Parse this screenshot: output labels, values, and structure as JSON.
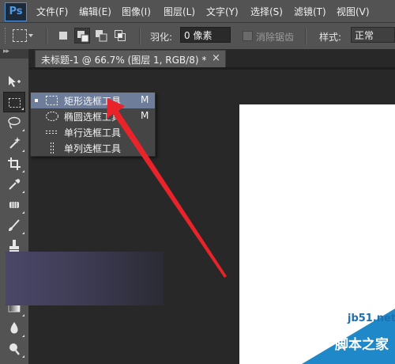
{
  "app": {
    "logo_text": "Ps"
  },
  "menu": {
    "items": [
      "文件(F)",
      "编辑(E)",
      "图像(I)",
      "图层(L)",
      "文字(Y)",
      "选择(S)",
      "滤镜(T)",
      "视图(V)"
    ]
  },
  "options_bar": {
    "feather_label": "羽化:",
    "feather_value": "0 像素",
    "antialias_label": "消除锯齿",
    "style_label": "样式:",
    "style_value": "正常"
  },
  "document": {
    "tab_title": "未标题-1 @ 66.7% (图层 1, RGB/8) *",
    "close_glyph": "×"
  },
  "flyout": {
    "items": [
      {
        "label": "矩形选框工具",
        "shortcut": "M",
        "icon": "rectangular-marquee-icon"
      },
      {
        "label": "椭圆选框工具",
        "shortcut": "M",
        "icon": "elliptical-marquee-icon"
      },
      {
        "label": "单行选框工具",
        "shortcut": "",
        "icon": "single-row-marquee-icon"
      },
      {
        "label": "单列选框工具",
        "shortcut": "",
        "icon": "single-column-marquee-icon"
      }
    ]
  },
  "watermark": {
    "url": "jb51.net",
    "name": "脚本之家"
  },
  "colors": {
    "highlight": "#6d7d9a",
    "arrow": "#e8232a",
    "watermark_blue": "#1f88c8"
  }
}
